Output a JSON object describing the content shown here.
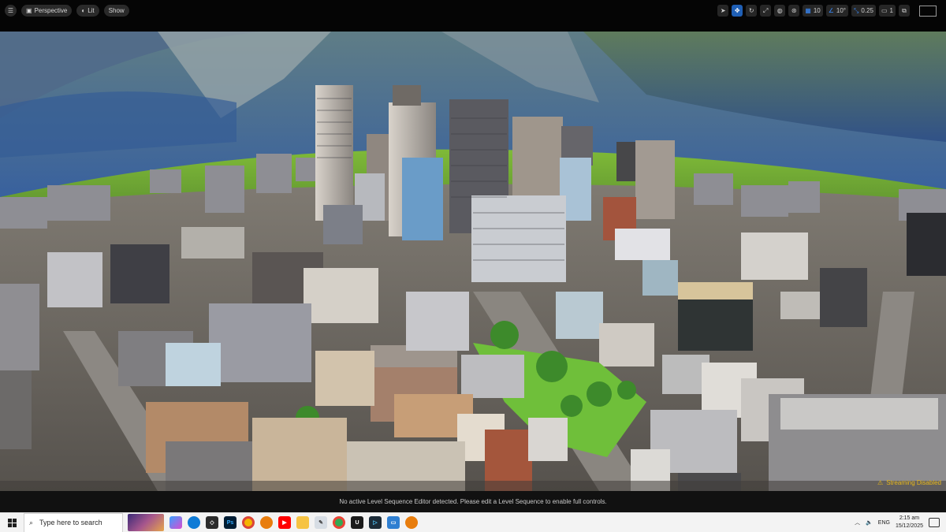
{
  "toolbar": {
    "view_mode": "Perspective",
    "lighting_mode": "Lit",
    "show_label": "Show",
    "grid_snap_value": "10",
    "rotation_snap_value": "10°",
    "scale_snap_value": "0.25",
    "camera_speed_value": "1"
  },
  "viewport": {
    "streaming_warning": "Streaming Disabled"
  },
  "status_bar": {
    "message": "No active Level Sequence Editor detected. Please edit a Level Sequence to enable full controls."
  },
  "taskbar": {
    "search_placeholder": "Type here to search",
    "language": "ENG",
    "time": "2:15 am",
    "date": "15/12/2025",
    "apps": [
      "widgets",
      "copilot",
      "edge",
      "unity",
      "photoshop",
      "chrome",
      "blender",
      "youtube",
      "file-explorer",
      "paint",
      "chrome-profile",
      "unreal-engine",
      "terminal",
      "remote-desktop",
      "blender-alt"
    ]
  },
  "colors": {
    "accent_blue": "#1f5fb5",
    "warning_yellow": "#e8b81a",
    "grass_green": "#6fbf3a"
  }
}
